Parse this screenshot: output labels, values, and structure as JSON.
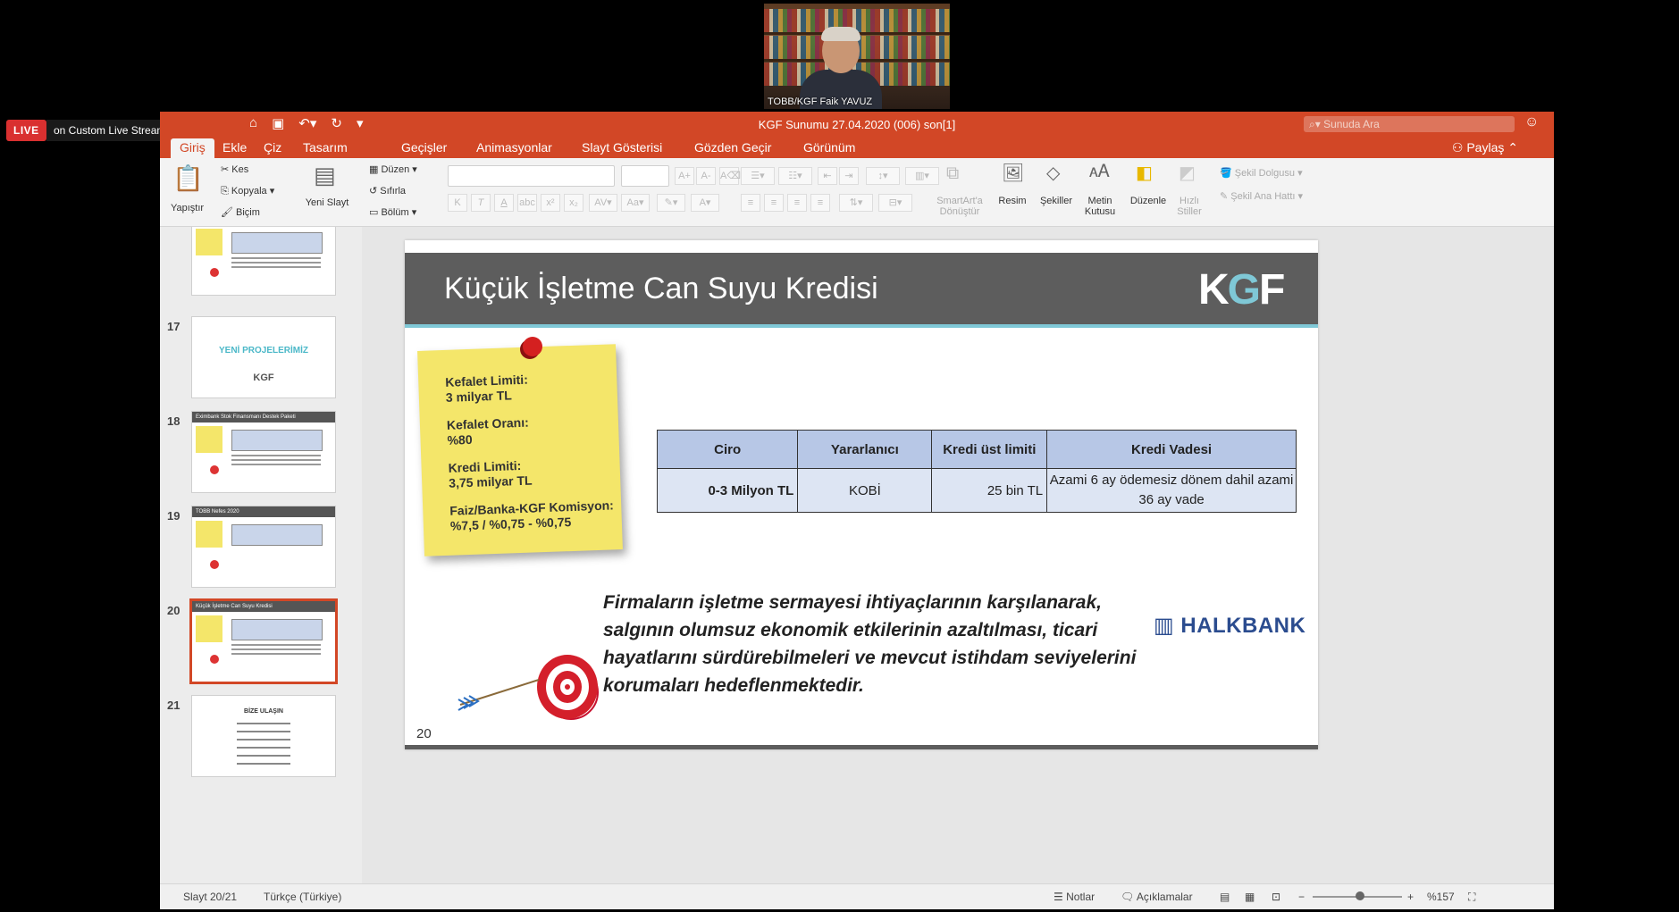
{
  "presenter": {
    "name": "TOBB/KGF Faik YAVUZ"
  },
  "live": {
    "badge": "LIVE",
    "service": "on Custom Live Streaming Service ▾"
  },
  "window": {
    "title": "KGF Sunumu 27.04.2020 (006) son[1]",
    "search_placeholder": "Sunuda Ara"
  },
  "ribbon_tabs": [
    "Giriş",
    "Ekle",
    "Çiz",
    "Tasarım",
    "Geçişler",
    "Animasyonlar",
    "Slayt Gösterisi",
    "Gözden Geçir",
    "Görünüm"
  ],
  "share_label": "Paylaş",
  "ribbon": {
    "paste": "Yapıştır",
    "cut": "Kes",
    "copy": "Kopyala",
    "format": "Biçim",
    "new_slide": "Yeni Slayt",
    "layout": "Düzen",
    "reset": "Sıfırla",
    "section": "Bölüm",
    "smartart": "SmartArt'a Dönüştür",
    "picture": "Resim",
    "shapes": "Şekiller",
    "textbox": "Metin Kutusu",
    "arrange": "Düzenle",
    "quick_styles": "Hızlı Stiller",
    "shape_fill": "Şekil Dolgusu",
    "shape_outline": "Şekil Ana Hattı"
  },
  "thumbnails": [
    {
      "num": "",
      "title": ""
    },
    {
      "num": "17",
      "title": "YENİ PROJELERİMİZ"
    },
    {
      "num": "18",
      "title": "Eximbank Stok Finansmanı Destek Paketi"
    },
    {
      "num": "19",
      "title": "TOBB Nefes 2020"
    },
    {
      "num": "20",
      "title": "Küçük İşletme Can Suyu Kredisi"
    },
    {
      "num": "21",
      "title": "BİZE ULAŞIN"
    }
  ],
  "slide": {
    "title": "Küçük İşletme Can Suyu Kredisi",
    "logo": "KGF",
    "sticky": [
      {
        "label": "Kefalet Limiti:",
        "value": "3 milyar TL"
      },
      {
        "label": "Kefalet Oranı:",
        "value": "%80"
      },
      {
        "label": "Kredi Limiti:",
        "value": "3,75 milyar TL"
      },
      {
        "label": "Faiz/Banka-KGF Komisyon:",
        "value": "%7,5 / %0,75 - %0,75"
      }
    ],
    "table": {
      "headers": [
        "Ciro",
        "Yararlanıcı",
        "Kredi üst limiti",
        "Kredi Vadesi"
      ],
      "row": [
        "0-3 Milyon TL",
        "KOBİ",
        "25 bin TL",
        "Azami 6 ay ödemesiz dönem dahil azami 36 ay vade"
      ]
    },
    "objective": "Firmaların işletme sermayesi ihtiyaçlarının karşılanarak, salgının olumsuz ekonomik etkilerinin azaltılması, ticari hayatlarını sürdürebilmeleri ve mevcut istihdam seviyelerini korumaları hedeflenmektedir.",
    "bank": "HALKBANK",
    "number": "20"
  },
  "status": {
    "slide": "Slayt 20/21",
    "language": "Türkçe (Türkiye)",
    "notes": "Notlar",
    "comments": "Açıklamalar",
    "zoom": "%157"
  }
}
